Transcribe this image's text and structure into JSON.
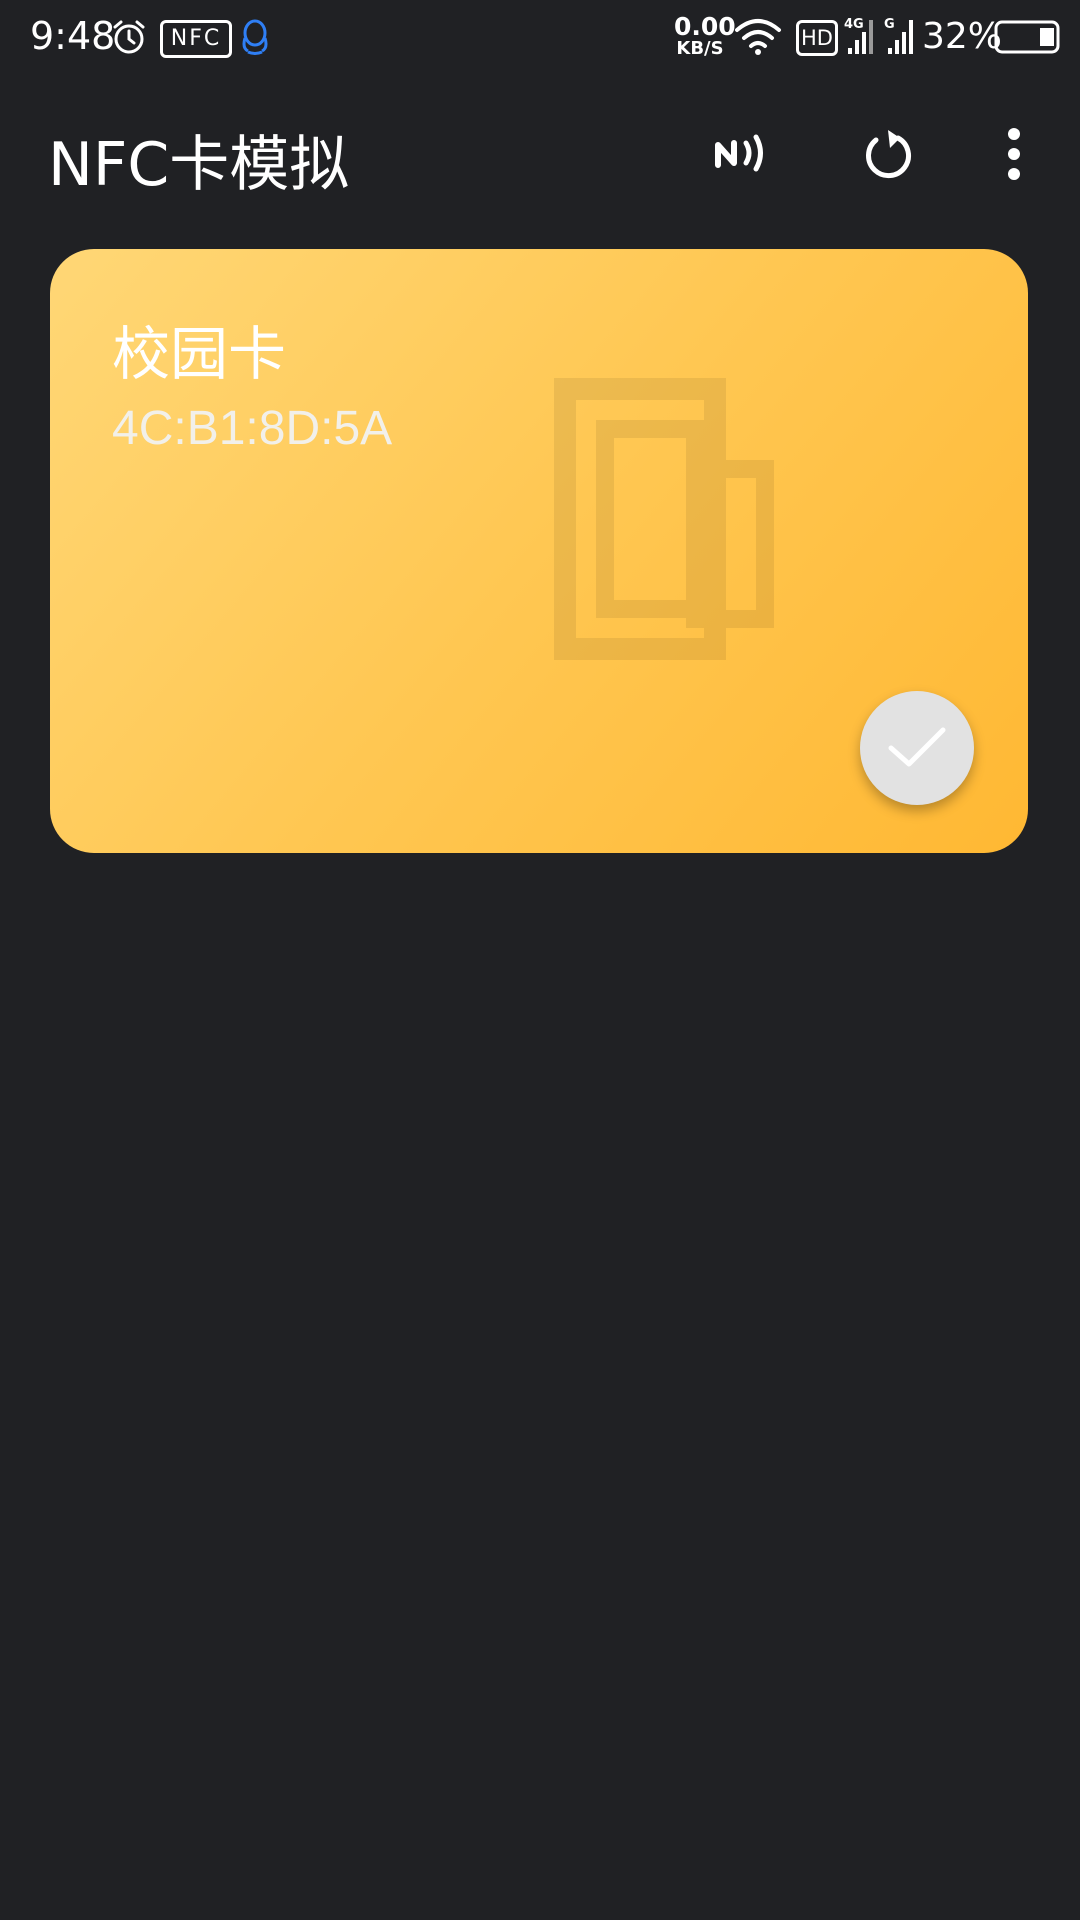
{
  "status_bar": {
    "time": "9:48",
    "nfc_label": "NFC",
    "net_speed_value": "0.00",
    "net_speed_unit": "KB/S",
    "hd_label": "HD",
    "sim1_label": "4G",
    "sim2_label": "G",
    "battery_percent": "32%",
    "battery_level": 0.32,
    "icons": [
      "alarm-icon",
      "qq-icon",
      "wifi-icon",
      "signal-icon",
      "battery-icon"
    ]
  },
  "app_bar": {
    "title": "NFC卡模拟",
    "actions": [
      "nfc-icon",
      "refresh-icon",
      "more-vert-icon"
    ]
  },
  "cards": [
    {
      "name": "校园卡",
      "uid": "4C:B1:8D:5A",
      "selected": true
    }
  ],
  "colors": {
    "background": "#202124",
    "card_gradient_start": "#ffd776",
    "card_gradient_end": "#ffb833",
    "check_button": "#e2e2e2",
    "qq_blue": "#2f7ff5"
  }
}
